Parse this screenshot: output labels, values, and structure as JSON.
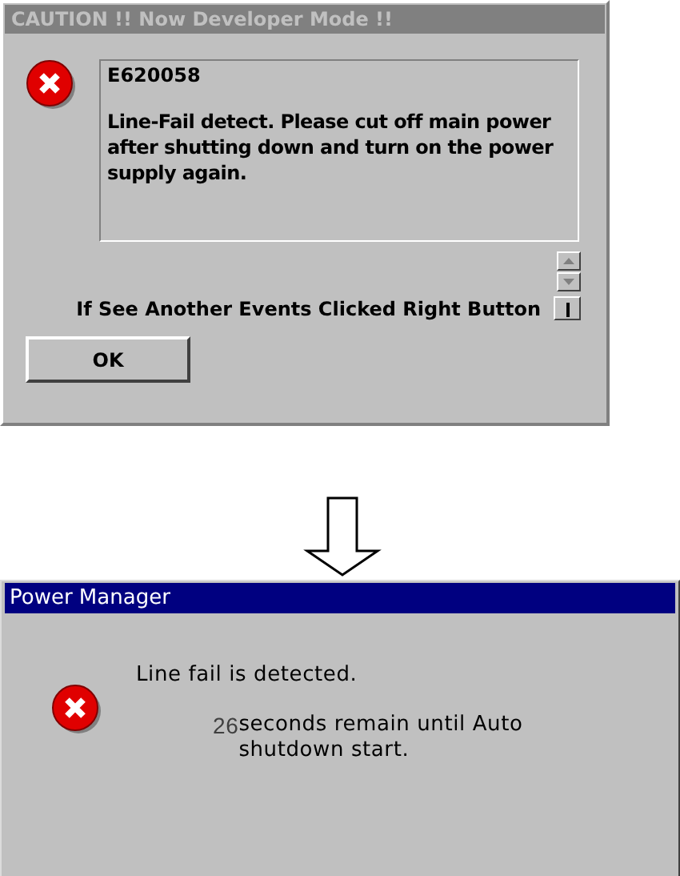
{
  "caution_dialog": {
    "title": "CAUTION !! Now Developer Mode !!",
    "code": "E620058",
    "message": "Line-Fail detect. Please cut off main power after shutting down and turn on the power supply again.",
    "hint": "If See Another Events Clicked Right Button",
    "ok_button": "OK"
  },
  "power_dialog": {
    "title": "Power Manager",
    "headline": "Line fail is detected.",
    "countdown": "26",
    "message": "seconds remain until Auto shutdown start."
  }
}
